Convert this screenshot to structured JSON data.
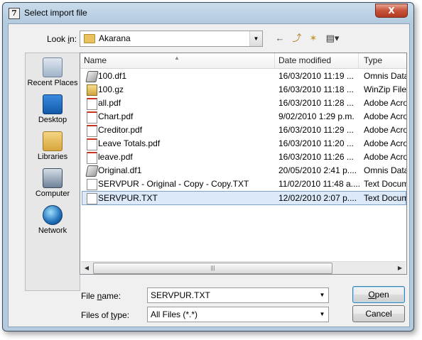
{
  "window": {
    "title": "Select import file",
    "close_label": "X"
  },
  "lookin": {
    "label": "Look in:",
    "label_plain_a": "Look ",
    "label_ul": "i",
    "label_plain_b": "n:",
    "value": "Akarana"
  },
  "toolbar": {
    "back": "←",
    "up": "⤴",
    "new_folder": "✶",
    "views": "▤▾"
  },
  "places": [
    {
      "label": "Recent Places",
      "icon": "recent-places-icon"
    },
    {
      "label": "Desktop",
      "icon": "desktop-icon"
    },
    {
      "label": "Libraries",
      "icon": "libraries-icon"
    },
    {
      "label": "Computer",
      "icon": "computer-icon"
    },
    {
      "label": "Network",
      "icon": "network-icon"
    }
  ],
  "columns": {
    "name": "Name",
    "date": "Date modified",
    "type": "Type"
  },
  "files": [
    {
      "name": "100.df1",
      "date": "16/03/2010 11:19 ...",
      "type": "Omnis Data",
      "icon": "df1"
    },
    {
      "name": "100.gz",
      "date": "16/03/2010 11:18 ...",
      "type": "WinZip File",
      "icon": "gz"
    },
    {
      "name": "all.pdf",
      "date": "16/03/2010 11:28 ...",
      "type": "Adobe Acro",
      "icon": "pdf"
    },
    {
      "name": "Chart.pdf",
      "date": "9/02/2010 1:29 p.m.",
      "type": "Adobe Acro",
      "icon": "pdf"
    },
    {
      "name": "Creditor.pdf",
      "date": "16/03/2010 11:29 ...",
      "type": "Adobe Acro",
      "icon": "pdf"
    },
    {
      "name": "Leave Totals.pdf",
      "date": "16/03/2010 11:20 ...",
      "type": "Adobe Acro",
      "icon": "pdf"
    },
    {
      "name": "leave.pdf",
      "date": "16/03/2010 11:26 ...",
      "type": "Adobe Acro",
      "icon": "pdf"
    },
    {
      "name": "Original.df1",
      "date": "20/05/2010 2:41 p....",
      "type": "Omnis Data",
      "icon": "df1"
    },
    {
      "name": "SERVPUR - Original - Copy - Copy.TXT",
      "date": "11/02/2010 11:48 a....",
      "type": "Text Docum",
      "icon": "txt"
    },
    {
      "name": "SERVPUR.TXT",
      "date": "12/02/2010 2:07 p....",
      "type": "Text Docum",
      "icon": "txt",
      "selected": true
    }
  ],
  "filename": {
    "label": "File name:",
    "label_plain_a": "File ",
    "label_ul": "n",
    "label_plain_b": "ame:",
    "value": "SERVPUR.TXT"
  },
  "filetype": {
    "label": "Files of type:",
    "label_plain_a": "Files of ",
    "label_ul": "t",
    "label_plain_b": "ype:",
    "value": "All Files (*.*)"
  },
  "buttons": {
    "open": "Open",
    "open_ul": "O",
    "open_rest": "pen",
    "cancel": "Cancel"
  }
}
